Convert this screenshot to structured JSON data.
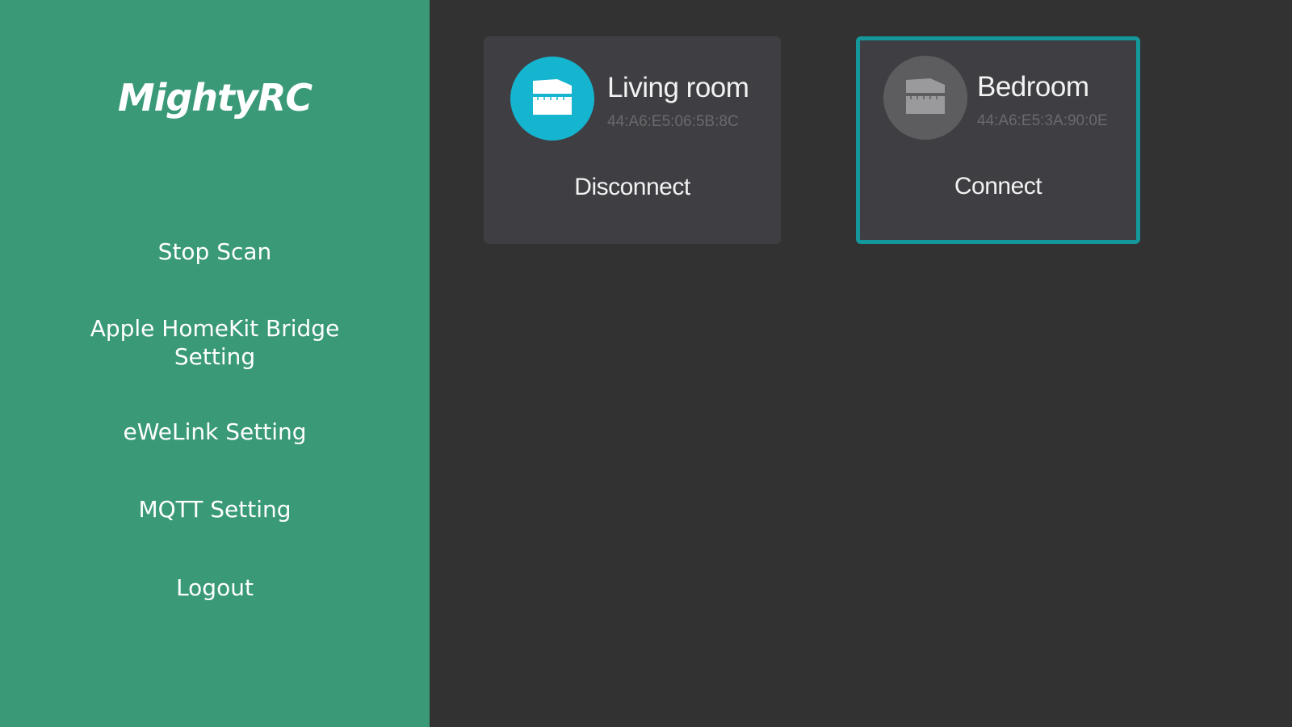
{
  "sidebar": {
    "logo": "MightyRC",
    "menu": {
      "stop_scan": "Stop Scan",
      "homekit_line1": "Apple HomeKit Bridge",
      "homekit_line2": "Setting",
      "ewelink": "eWeLink Setting",
      "mqtt": "MQTT Setting",
      "logout": "Logout"
    }
  },
  "devices": [
    {
      "name": "Living room",
      "mac": "44:A6:E5:06:5B:8C",
      "action": "Disconnect",
      "status": "connected",
      "icon": "blinds-icon",
      "icon_color": "#15b5cf"
    },
    {
      "name": "Bedroom",
      "mac": "44:A6:E5:3A:90:0E",
      "action": "Connect",
      "status": "disconnected",
      "selected": true,
      "icon": "blinds-icon",
      "icon_color": "#5d5d5f"
    }
  ],
  "colors": {
    "sidebar_bg": "#3a9a78",
    "main_bg": "#323232",
    "card_bg": "#3f3e43",
    "focus_border": "#14979a"
  }
}
